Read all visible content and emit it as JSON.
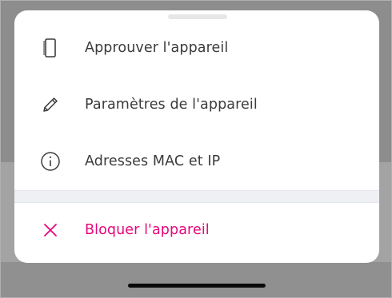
{
  "sheet": {
    "items": [
      {
        "label": "Approuver l'appareil",
        "icon": "phone-icon"
      },
      {
        "label": "Paramètres de l'appareil",
        "icon": "pencil-icon"
      },
      {
        "label": "Adresses MAC et IP",
        "icon": "info-icon"
      }
    ],
    "block": {
      "label": "Bloquer l'appareil",
      "icon": "close-icon"
    }
  },
  "colors": {
    "text": "#3b3b3b",
    "danger": "#e5077a",
    "separator": "#eef0f4",
    "backdrop": "#8d8d8d"
  }
}
